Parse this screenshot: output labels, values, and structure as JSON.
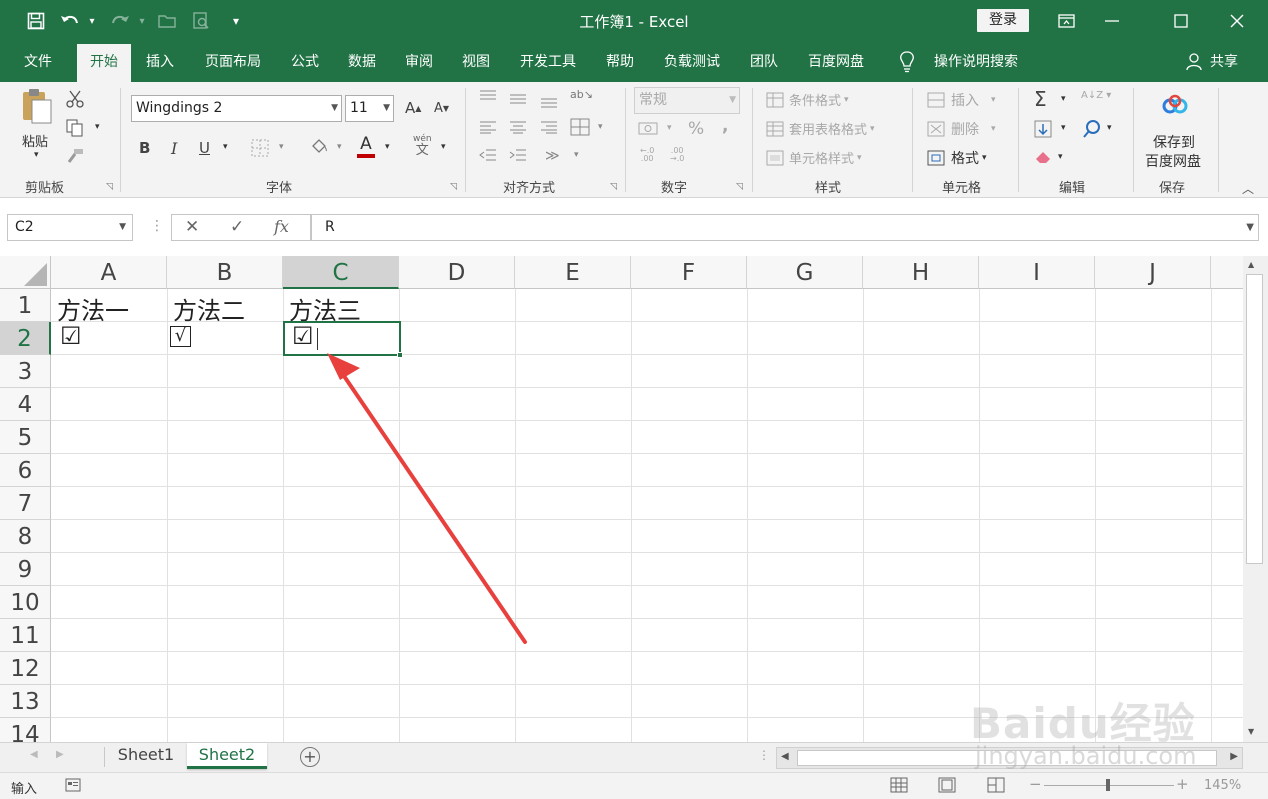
{
  "title_bar": {
    "title": "工作簿1  -  Excel",
    "sign_in": "登录",
    "quick_access": {
      "save_icon": "save-icon",
      "undo_icon": "undo-icon",
      "redo_icon": "redo-icon",
      "customize": "▾"
    }
  },
  "tabs": [
    "文件",
    "开始",
    "插入",
    "页面布局",
    "公式",
    "数据",
    "审阅",
    "视图",
    "开发工具",
    "帮助",
    "负载测试",
    "团队",
    "百度网盘"
  ],
  "active_tab": "开始",
  "tell_me": "操作说明搜索",
  "share": "共享",
  "ribbon": {
    "clipboard": {
      "label": "剪贴板",
      "paste": "粘贴"
    },
    "font": {
      "label": "字体",
      "name": "Wingdings 2",
      "size": "11",
      "bold": "B",
      "italic": "I",
      "underline": "U",
      "grow": "A",
      "shrink": "A",
      "font_color_accent": "#c00000",
      "phonetic": "wén"
    },
    "alignment": {
      "label": "对齐方式"
    },
    "number": {
      "label": "数字",
      "format": "常规",
      "percent": "%",
      "comma": ","
    },
    "styles": {
      "label": "样式",
      "conditional": "条件格式",
      "table": "套用表格格式",
      "cell_styles": "单元格样式"
    },
    "cells": {
      "label": "单元格",
      "insert": "插入",
      "delete": "删除",
      "format": "格式"
    },
    "editing": {
      "label": "编辑",
      "sum": "Σ"
    },
    "save": {
      "label": "保存",
      "button_line1": "保存到",
      "button_line2": "百度网盘"
    }
  },
  "formula_bar": {
    "name_box": "C2",
    "cancel": "✕",
    "enter": "✓",
    "fx": "fx",
    "content": "R"
  },
  "columns": [
    "A",
    "B",
    "C",
    "D",
    "E",
    "F",
    "G",
    "H",
    "I",
    "J"
  ],
  "selected_column": "C",
  "rows": [
    "1",
    "2",
    "3",
    "4",
    "5",
    "6",
    "7",
    "8",
    "9",
    "10",
    "11",
    "12",
    "13",
    "14"
  ],
  "selected_row": "2",
  "cells": {
    "A1": "方法一",
    "B1": "方法二",
    "C1": "方法三",
    "A2": "☑",
    "B2": "√",
    "C2": "☑"
  },
  "sheets": [
    "Sheet1",
    "Sheet2"
  ],
  "active_sheet": "Sheet2",
  "status": {
    "mode": "输入",
    "zoom": "145%"
  },
  "watermark": {
    "brand": "Baidu经验",
    "url": "jingyan.baidu.com"
  },
  "colors": {
    "accent": "#217346",
    "arrow": "#e8413d"
  }
}
